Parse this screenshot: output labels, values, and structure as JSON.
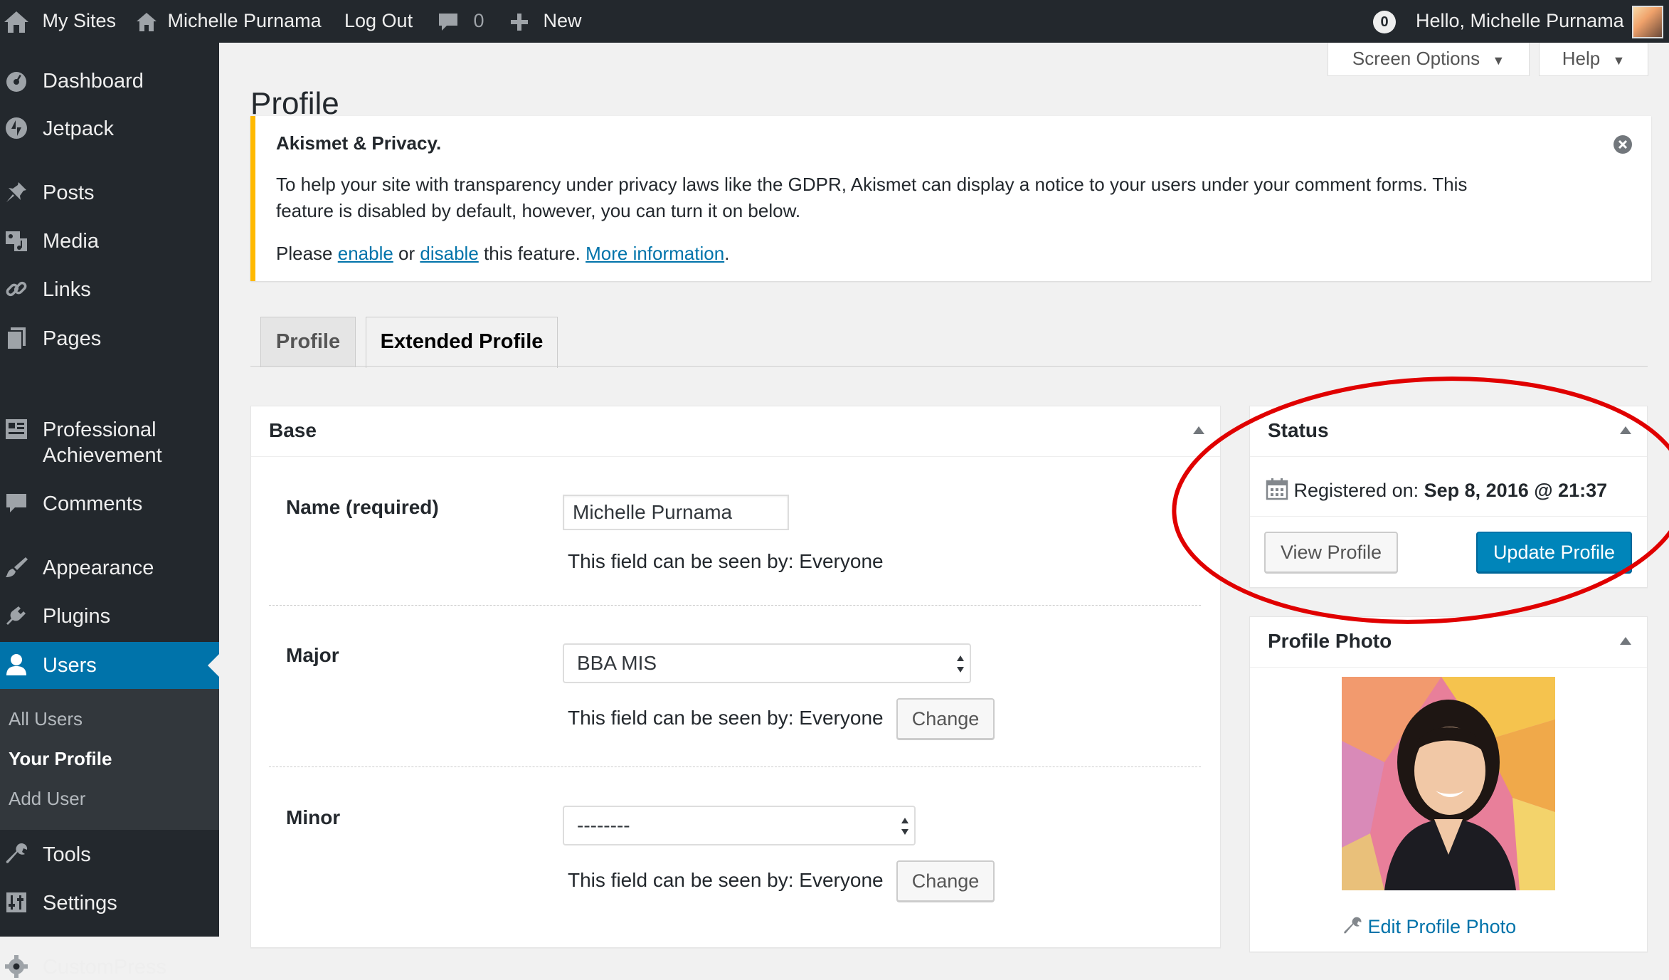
{
  "adminbar": {
    "my_sites": "My Sites",
    "site_name": "Michelle Purnama",
    "logout": "Log Out",
    "comments_count": "0",
    "new_label": "New",
    "notifications_count": "0",
    "greeting": "Hello, Michelle Purnama"
  },
  "sidebar": {
    "items": [
      {
        "label": "Dashboard",
        "icon": "dashboard-icon"
      },
      {
        "label": "Jetpack",
        "icon": "jetpack-icon"
      },
      {
        "label": "Posts",
        "icon": "pin-icon"
      },
      {
        "label": "Media",
        "icon": "media-icon"
      },
      {
        "label": "Links",
        "icon": "link-icon"
      },
      {
        "label": "Pages",
        "icon": "pages-icon"
      },
      {
        "label": "Professional",
        "label2": "Achievement",
        "icon": "portfolio-icon"
      },
      {
        "label": "Comments",
        "icon": "comment-icon"
      },
      {
        "label": "Appearance",
        "icon": "brush-icon"
      },
      {
        "label": "Plugins",
        "icon": "plugin-icon"
      },
      {
        "label": "Users",
        "icon": "user-icon"
      },
      {
        "label": "Tools",
        "icon": "wrench-icon"
      },
      {
        "label": "Settings",
        "icon": "settings-icon"
      },
      {
        "label": "CustomPress",
        "icon": "gear-icon"
      }
    ],
    "submenu": [
      "All Users",
      "Your Profile",
      "Add User"
    ]
  },
  "screen_options": "Screen Options",
  "help": "Help",
  "page_title": "Profile",
  "notice": {
    "title": "Akismet & Privacy.",
    "line1": "To help your site with transparency under privacy laws like the GDPR, Akismet can display a notice to your users under your comment forms. This",
    "line2": "feature is disabled by default, however, you can turn it on below.",
    "please": "Please ",
    "enable": "enable",
    "or": " or ",
    "disable": "disable",
    "this_feature": " this feature. ",
    "more_info": "More information",
    "period": "."
  },
  "tabs": [
    "Profile",
    "Extended Profile"
  ],
  "base": {
    "title": "Base",
    "fields": [
      {
        "label": "Name (required)",
        "value": "Michelle Purnama",
        "visibility": "This field can be seen by: Everyone"
      },
      {
        "label": "Major",
        "value": "BBA MIS",
        "visibility": "This field can be seen by: Everyone",
        "button": "Change"
      },
      {
        "label": "Minor",
        "value": "--------",
        "visibility": "This field can be seen by: Everyone",
        "button": "Change"
      }
    ]
  },
  "status": {
    "title": "Status",
    "registered_label": "Registered on: ",
    "registered_date": "Sep 8, 2016 @ 21:37",
    "view_profile": "View Profile",
    "update_profile": "Update Profile"
  },
  "profile_photo": {
    "title": "Profile Photo",
    "edit_link": "Edit Profile Photo"
  },
  "colors": {
    "adminbar_bg": "#23282d",
    "sidebar_bg": "#23282d",
    "active_blue": "#0073aa",
    "notice_yellow": "#ffb900",
    "primary_button": "#0085ba",
    "annotation_red": "#e00000"
  }
}
